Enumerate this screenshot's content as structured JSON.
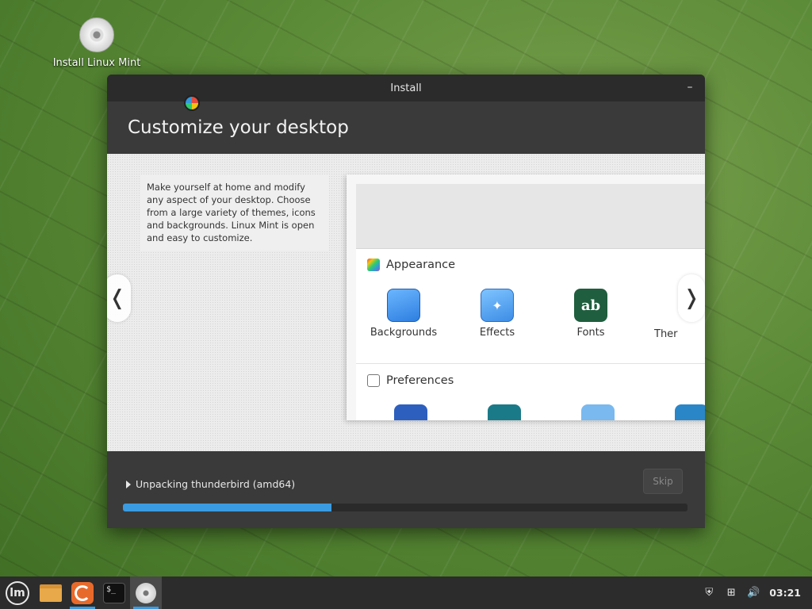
{
  "desktop": {
    "icon_label": "Install Linux Mint"
  },
  "window": {
    "title": "Install",
    "minimize_glyph": "–",
    "heading": "Customize your desktop",
    "description": "Make yourself at home and modify any aspect of your desktop. Choose from a large variety of themes, icons and backgrounds. Linux Mint is open and easy to customize.",
    "prev_glyph": "❬",
    "next_glyph": "❭",
    "screenshot": {
      "category_appearance": "Appearance",
      "category_preferences": "Preferences",
      "apps": [
        {
          "label": "Backgrounds"
        },
        {
          "label": "Effects",
          "glyph": "✦"
        },
        {
          "label": "Fonts",
          "glyph": "ab"
        },
        {
          "label": "Ther"
        }
      ]
    },
    "status_text": "Unpacking thunderbird (amd64)",
    "skip_label": "Skip",
    "progress_percent": 37
  },
  "taskbar": {
    "mint_glyph": "lm",
    "terminal_glyph": "$_",
    "tray_shield_glyph": "⛨",
    "tray_network_glyph": "⊞",
    "tray_volume_glyph": "🔊",
    "clock": "03:21"
  },
  "colors": {
    "accent": "#3a9be0"
  }
}
